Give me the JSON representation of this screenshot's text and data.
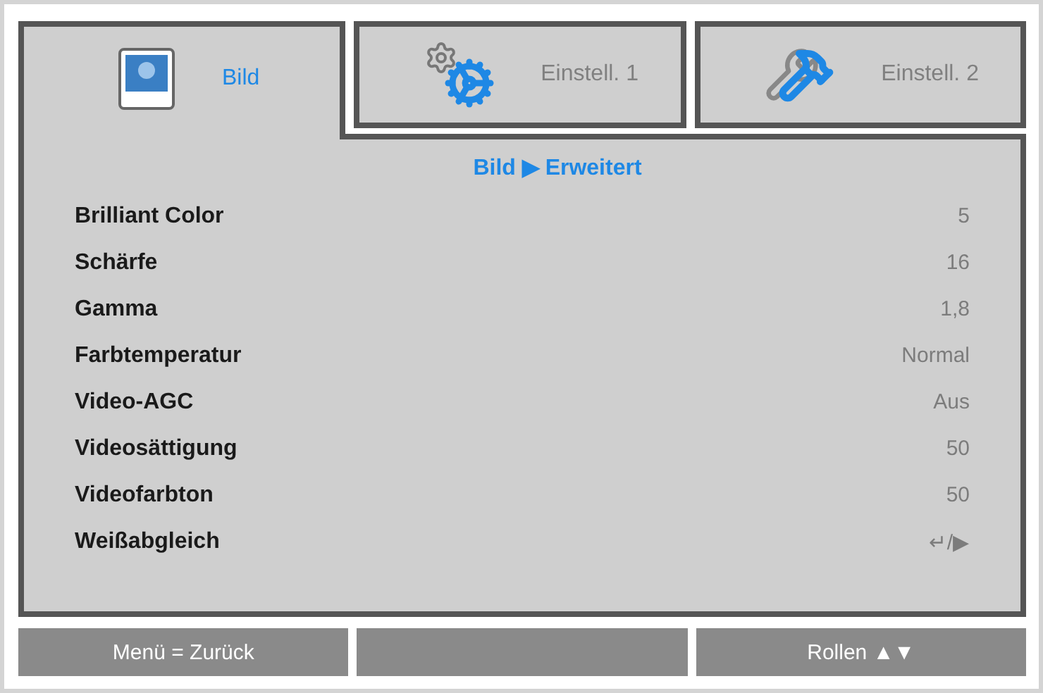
{
  "tabs": [
    {
      "label": "Bild",
      "kind": "picture",
      "selected": true
    },
    {
      "label": "Einstell. 1",
      "kind": "gears",
      "selected": false
    },
    {
      "label": "Einstell. 2",
      "kind": "tools",
      "selected": false
    }
  ],
  "breadcrumb": "Bild ▶ Erweitert",
  "rows": [
    {
      "label": "Brilliant Color",
      "value": "5"
    },
    {
      "label": "Schärfe",
      "value": "16"
    },
    {
      "label": "Gamma",
      "value": "1,8"
    },
    {
      "label": "Farbtemperatur",
      "value": "Normal"
    },
    {
      "label": "Video-AGC",
      "value": "Aus"
    },
    {
      "label": "Videosättigung",
      "value": "50"
    },
    {
      "label": "Videofarbton",
      "value": "50"
    },
    {
      "label": "Weißabgleich",
      "value": "↵/▶"
    }
  ],
  "footer": {
    "left": "Menü = Zurück",
    "right": "Rollen ▲▼"
  }
}
